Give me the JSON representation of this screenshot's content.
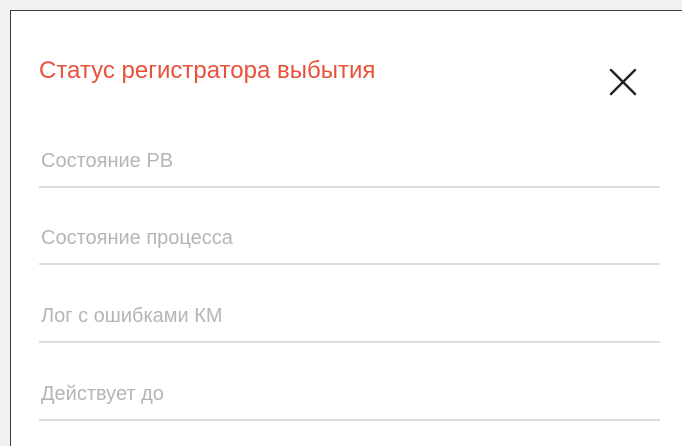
{
  "dialog": {
    "title": "Статус регистратора выбытия",
    "close_icon": "close-icon",
    "fields": [
      {
        "label": "Состояние РВ"
      },
      {
        "label": "Состояние процесса"
      },
      {
        "label": "Лог с ошибками КМ"
      },
      {
        "label": "Действует до"
      }
    ]
  },
  "colors": {
    "title": "#e8513a",
    "label": "#b5b5b5",
    "divider": "#dcdcdc"
  }
}
